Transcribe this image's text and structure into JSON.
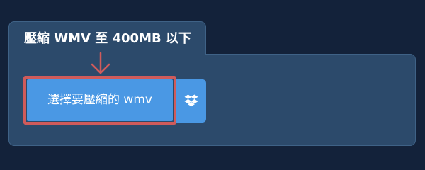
{
  "tab": {
    "title": "壓縮 WMV 至 400MB 以下"
  },
  "upload": {
    "select_label": "選擇要壓縮的 wmv"
  },
  "icons": {
    "pointer_arrow": "arrow-down-icon",
    "dropbox": "dropbox-icon"
  },
  "colors": {
    "background": "#13223a",
    "panel": "#2c4a6b",
    "button": "#4a98e4",
    "highlight": "#d05b5b"
  }
}
